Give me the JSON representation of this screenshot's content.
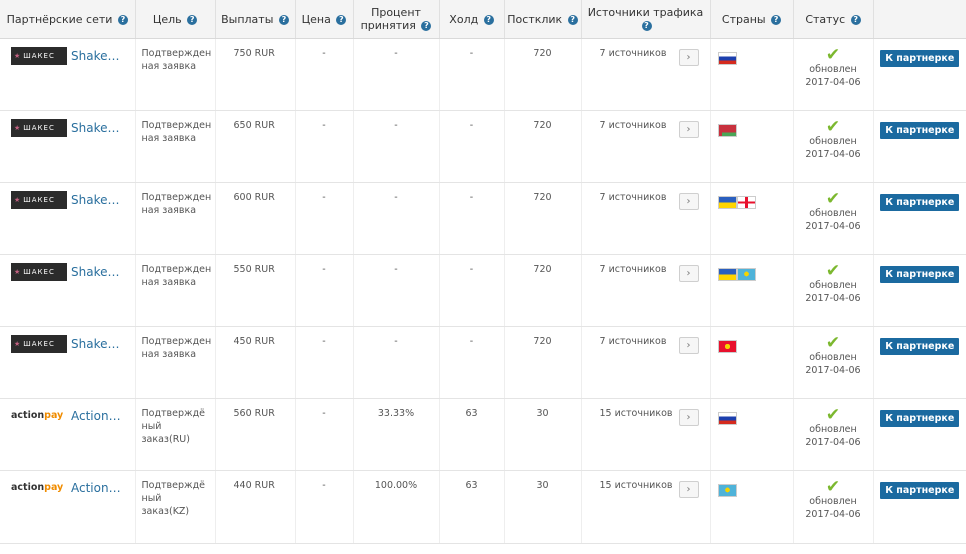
{
  "headers": {
    "network": "Партнёрские сети",
    "goal": "Цель",
    "payout": "Выплаты",
    "price": "Цена",
    "acceptance_line1": "Процент",
    "acceptance_line2": "принятия",
    "hold": "Холд",
    "postclick": "Постклик",
    "traffic": "Источники трафика",
    "countries": "Страны",
    "status": "Статус",
    "help_glyph": "?"
  },
  "colors": {
    "accent": "#1b6aa0",
    "link": "#2a6f9e",
    "check": "#7cb82f",
    "actionpay_orange": "#f08c00"
  },
  "rows": [
    {
      "logo": "shakes",
      "logo_text": "ШАКЕС",
      "network": "Shakes...",
      "goal": "Подтвержден ная заявка",
      "payout": "750 RUR",
      "price": "-",
      "acceptance": "-",
      "hold": "-",
      "postclick": "720",
      "sources": "7 источников",
      "countries": [
        "ru"
      ],
      "status": "обновлен",
      "date": "2017-04-06",
      "button": "К партнерке"
    },
    {
      "logo": "shakes",
      "logo_text": "ШАКЕС",
      "network": "Shakes...",
      "goal": "Подтвержден ная заявка",
      "payout": "650 RUR",
      "price": "-",
      "acceptance": "-",
      "hold": "-",
      "postclick": "720",
      "sources": "7 источников",
      "countries": [
        "by"
      ],
      "status": "обновлен",
      "date": "2017-04-06",
      "button": "К партнерке"
    },
    {
      "logo": "shakes",
      "logo_text": "ШАКЕС",
      "network": "Shakes...",
      "goal": "Подтвержден ная заявка",
      "payout": "600 RUR",
      "price": "-",
      "acceptance": "-",
      "hold": "-",
      "postclick": "720",
      "sources": "7 источников",
      "countries": [
        "ua",
        "ge"
      ],
      "status": "обновлен",
      "date": "2017-04-06",
      "button": "К партнерке"
    },
    {
      "logo": "shakes",
      "logo_text": "ШАКЕС",
      "network": "Shakes...",
      "goal": "Подтвержден ная заявка",
      "payout": "550 RUR",
      "price": "-",
      "acceptance": "-",
      "hold": "-",
      "postclick": "720",
      "sources": "7 источников",
      "countries": [
        "ua",
        "kz"
      ],
      "status": "обновлен",
      "date": "2017-04-06",
      "button": "К партнерке"
    },
    {
      "logo": "shakes",
      "logo_text": "ШАКЕС",
      "network": "Shakes...",
      "goal": "Подтвержден ная заявка",
      "payout": "450 RUR",
      "price": "-",
      "acceptance": "-",
      "hold": "-",
      "postclick": "720",
      "sources": "7 источников",
      "countries": [
        "kg"
      ],
      "status": "обновлен",
      "date": "2017-04-06",
      "button": "К партнерке"
    },
    {
      "logo": "actionpay",
      "logo_text_a": "action",
      "logo_text_b": "pay",
      "network": "Actionp...",
      "goal": "Подтверждё ный заказ(RU)",
      "payout": "560 RUR",
      "price": "-",
      "acceptance": "33.33%",
      "hold": "63",
      "postclick": "30",
      "sources": "15 источников",
      "countries": [
        "ru"
      ],
      "status": "обновлен",
      "date": "2017-04-06",
      "button": "К партнерке"
    },
    {
      "logo": "actionpay",
      "logo_text_a": "action",
      "logo_text_b": "pay",
      "network": "Actionp...",
      "goal": "Подтверждё ный заказ(KZ)",
      "payout": "440 RUR",
      "price": "-",
      "acceptance": "100.00%",
      "hold": "63",
      "postclick": "30",
      "sources": "15 источников",
      "countries": [
        "kz"
      ],
      "status": "обновлен",
      "date": "2017-04-06",
      "button": "К партнерке"
    }
  ]
}
